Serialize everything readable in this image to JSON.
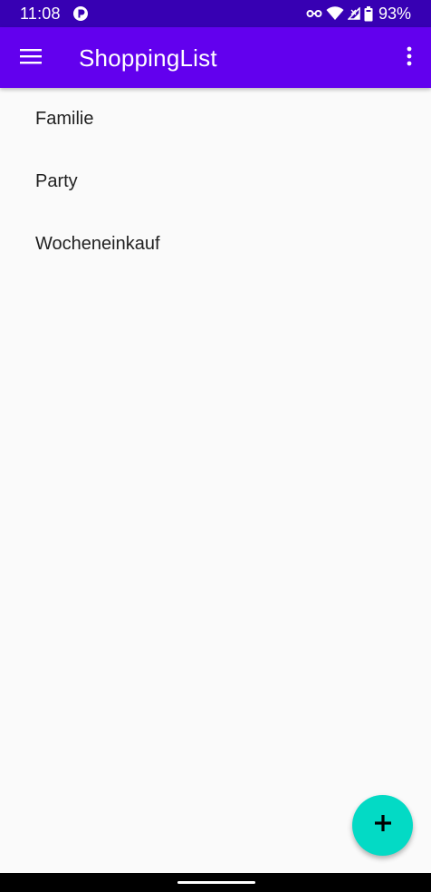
{
  "status_bar": {
    "time": "11:08",
    "battery": "93%",
    "icons": [
      "app-notification-icon",
      "vpn-key-icon",
      "wifi-icon",
      "signal-icon",
      "battery-icon"
    ]
  },
  "app_bar": {
    "title": "ShoppingList",
    "menu_icon": "hamburger-menu-icon",
    "overflow_icon": "more-vert-icon"
  },
  "lists": [
    {
      "label": "Familie"
    },
    {
      "label": "Party"
    },
    {
      "label": "Wocheneinkauf"
    }
  ],
  "fab": {
    "icon": "plus-icon"
  },
  "colors": {
    "status_bar": "#3700b3",
    "app_bar": "#6200ee",
    "fab": "#03dac5",
    "background": "#fafafa",
    "text": "#212121"
  }
}
